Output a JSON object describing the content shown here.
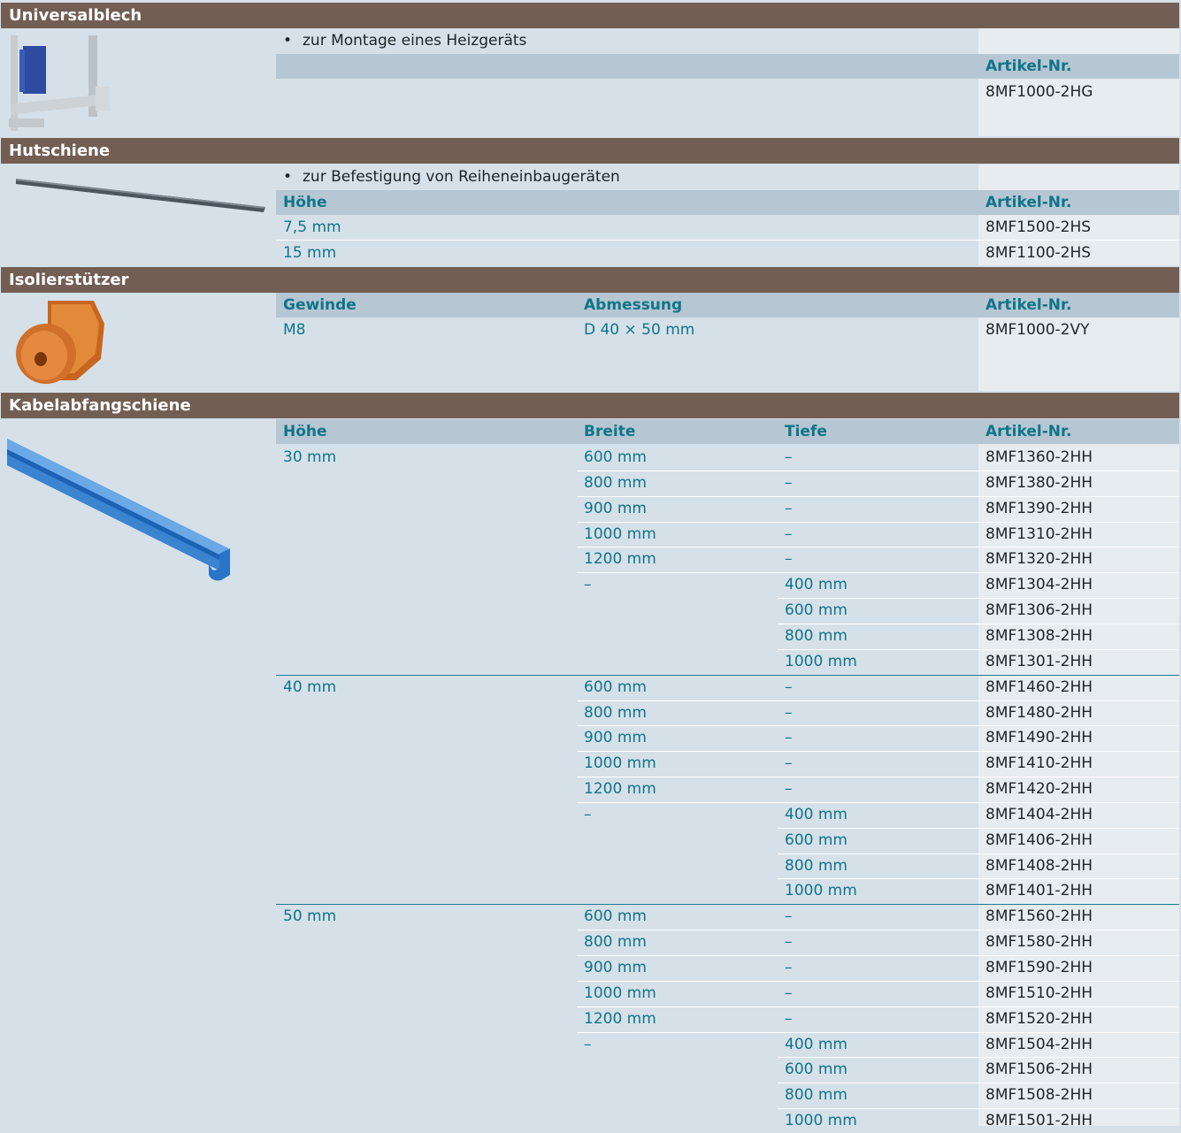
{
  "sections": {
    "universalblech": {
      "title": "Universalblech",
      "note": "zur Montage eines Heizgeräts",
      "headers": {
        "artikel": "Artikel-Nr."
      },
      "rows": [
        {
          "artikel": "8MF1000-2HG"
        }
      ]
    },
    "hutschiene": {
      "title": "Hutschiene",
      "note": "zur Befestigung von Reiheneinbaugeräten",
      "headers": {
        "hoehe": "Höhe",
        "artikel": "Artikel-Nr."
      },
      "rows": [
        {
          "hoehe": "7,5 mm",
          "artikel": "8MF1500-2HS"
        },
        {
          "hoehe": "15 mm",
          "artikel": "8MF1100-2HS"
        }
      ]
    },
    "isolierstuetzer": {
      "title": "Isolierstützer",
      "headers": {
        "gewinde": "Gewinde",
        "abmessung": "Abmessung",
        "artikel": "Artikel-Nr."
      },
      "rows": [
        {
          "gewinde": "M8",
          "abmessung": "D 40 × 50 mm",
          "artikel": "8MF1000-2VY"
        }
      ]
    },
    "kabelabfangschiene": {
      "title": "Kabelabfangschiene",
      "headers": {
        "hoehe": "Höhe",
        "breite": "Breite",
        "tiefe": "Tiefe",
        "artikel": "Artikel-Nr."
      },
      "groups": [
        {
          "hoehe": "30 mm",
          "rows": [
            {
              "breite": "600 mm",
              "tiefe": "–",
              "artikel": "8MF1360-2HH"
            },
            {
              "breite": "800 mm",
              "tiefe": "–",
              "artikel": "8MF1380-2HH"
            },
            {
              "breite": "900 mm",
              "tiefe": "–",
              "artikel": "8MF1390-2HH"
            },
            {
              "breite": "1000 mm",
              "tiefe": "–",
              "artikel": "8MF1310-2HH"
            },
            {
              "breite": "1200 mm",
              "tiefe": "–",
              "artikel": "8MF1320-2HH"
            },
            {
              "breite": "–",
              "tiefe": "400 mm",
              "artikel": "8MF1304-2HH"
            },
            {
              "breite": "",
              "tiefe": "600 mm",
              "artikel": "8MF1306-2HH"
            },
            {
              "breite": "",
              "tiefe": "800 mm",
              "artikel": "8MF1308-2HH"
            },
            {
              "breite": "",
              "tiefe": "1000 mm",
              "artikel": "8MF1301-2HH"
            }
          ]
        },
        {
          "hoehe": "40 mm",
          "rows": [
            {
              "breite": "600 mm",
              "tiefe": "–",
              "artikel": "8MF1460-2HH"
            },
            {
              "breite": "800 mm",
              "tiefe": "–",
              "artikel": "8MF1480-2HH"
            },
            {
              "breite": "900 mm",
              "tiefe": "–",
              "artikel": "8MF1490-2HH"
            },
            {
              "breite": "1000 mm",
              "tiefe": "–",
              "artikel": "8MF1410-2HH"
            },
            {
              "breite": "1200 mm",
              "tiefe": "–",
              "artikel": "8MF1420-2HH"
            },
            {
              "breite": "–",
              "tiefe": "400 mm",
              "artikel": "8MF1404-2HH"
            },
            {
              "breite": "",
              "tiefe": "600 mm",
              "artikel": "8MF1406-2HH"
            },
            {
              "breite": "",
              "tiefe": "800 mm",
              "artikel": "8MF1408-2HH"
            },
            {
              "breite": "",
              "tiefe": "1000 mm",
              "artikel": "8MF1401-2HH"
            }
          ]
        },
        {
          "hoehe": "50 mm",
          "rows": [
            {
              "breite": "600 mm",
              "tiefe": "–",
              "artikel": "8MF1560-2HH"
            },
            {
              "breite": "800 mm",
              "tiefe": "–",
              "artikel": "8MF1580-2HH"
            },
            {
              "breite": "900 mm",
              "tiefe": "–",
              "artikel": "8MF1590-2HH"
            },
            {
              "breite": "1000 mm",
              "tiefe": "–",
              "artikel": "8MF1510-2HH"
            },
            {
              "breite": "1200 mm",
              "tiefe": "–",
              "artikel": "8MF1520-2HH"
            },
            {
              "breite": "–",
              "tiefe": "400 mm",
              "artikel": "8MF1504-2HH"
            },
            {
              "breite": "",
              "tiefe": "600 mm",
              "artikel": "8MF1506-2HH"
            },
            {
              "breite": "",
              "tiefe": "800 mm",
              "artikel": "8MF1508-2HH"
            },
            {
              "breite": "",
              "tiefe": "1000 mm",
              "artikel": "8MF1501-2HH"
            }
          ]
        }
      ]
    }
  }
}
